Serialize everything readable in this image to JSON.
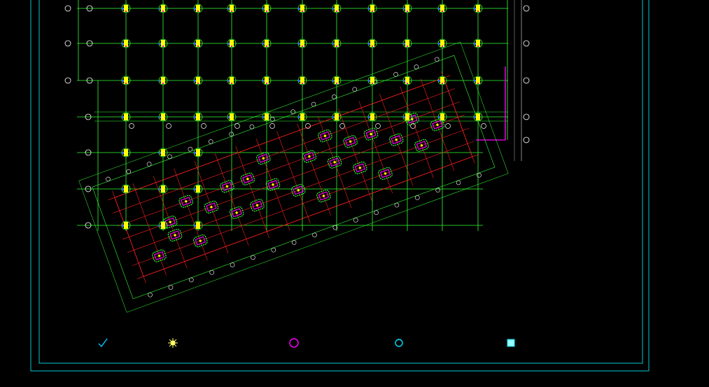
{
  "drawing": {
    "frame_color": "#00c8d0",
    "grid_color": "#33ff33",
    "rotated_grid_color": "#ff2020",
    "column_color": "#ffff00",
    "pile_cap_color": "#ff00ff",
    "axis_bubble_color": "#ffffff"
  },
  "notes": {
    "lines": [
      "",
      "",
      "",
      "",
      "",
      "",
      "",
      "",
      "",
      "",
      "",
      "",
      "",
      "",
      "",
      "",
      "",
      "",
      "",
      "",
      "",
      "",
      "",
      "",
      "",
      "",
      "",
      "",
      "",
      "",
      "",
      ""
    ]
  },
  "plan_caption": {
    "title": "",
    "lines": [
      "",
      "",
      ""
    ]
  },
  "legend": {
    "items": [
      {
        "icon": "check-mark-icon",
        "label": ""
      },
      {
        "icon": "starburst-icon",
        "label": ""
      },
      {
        "icon": "magenta-circle-icon",
        "label": ""
      },
      {
        "icon": "cyan-circle-icon",
        "label": ""
      },
      {
        "icon": "cyan-square-icon",
        "label": ""
      }
    ]
  }
}
